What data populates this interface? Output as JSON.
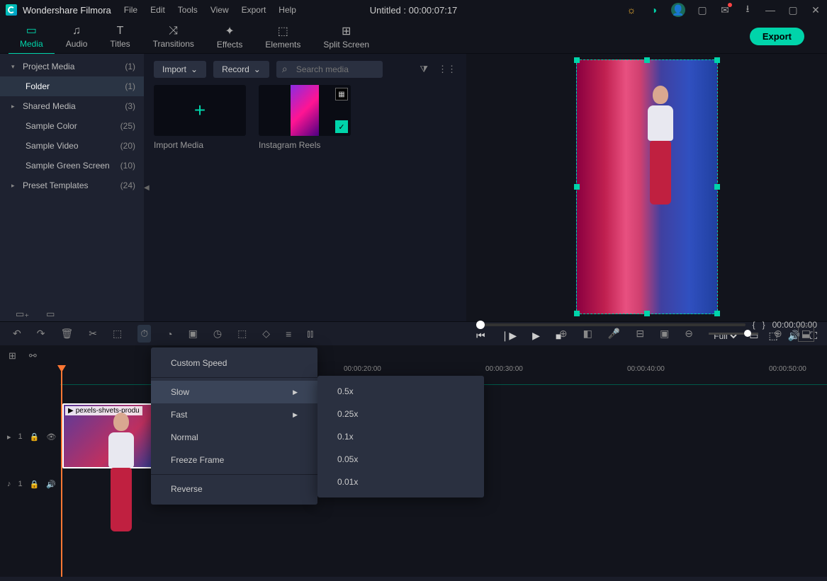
{
  "app": {
    "name": "Wondershare Filmora"
  },
  "menu": {
    "file": "File",
    "edit": "Edit",
    "tools": "Tools",
    "view": "View",
    "export": "Export",
    "help": "Help"
  },
  "document": {
    "title": "Untitled : 00:00:07:17"
  },
  "toolbar": {
    "media": "Media",
    "audio": "Audio",
    "titles": "Titles",
    "transitions": "Transitions",
    "effects": "Effects",
    "elements": "Elements",
    "split_screen": "Split Screen",
    "export": "Export"
  },
  "sidebar": {
    "items": [
      {
        "label": "Project Media",
        "count": "(1)",
        "arrow": "▾"
      },
      {
        "label": "Folder",
        "count": "(1)",
        "arrow": ""
      },
      {
        "label": "Shared Media",
        "count": "(3)",
        "arrow": "▸"
      },
      {
        "label": "Sample Color",
        "count": "(25)",
        "arrow": ""
      },
      {
        "label": "Sample Video",
        "count": "(20)",
        "arrow": ""
      },
      {
        "label": "Sample Green Screen",
        "count": "(10)",
        "arrow": ""
      },
      {
        "label": "Preset Templates",
        "count": "(24)",
        "arrow": "▸"
      }
    ]
  },
  "content": {
    "import": "Import",
    "record": "Record",
    "search_placeholder": "Search media",
    "thumb_import": "Import Media",
    "thumb_reels": "Instagram Reels"
  },
  "preview": {
    "brace_open": "{",
    "brace_close": "}",
    "timecode": "00:00:00:00",
    "full": "Full"
  },
  "ruler": {
    "t0": "|",
    "t1": "00:00:20:00",
    "t2": "00:00:30:00",
    "t3": "00:00:40:00",
    "t4": "00:00:50:00"
  },
  "track": {
    "video_label": "1",
    "audio_label": "1",
    "clip_name": "pexels-shvets-produ"
  },
  "ctx": {
    "custom": "Custom Speed",
    "slow": "Slow",
    "fast": "Fast",
    "normal": "Normal",
    "freeze": "Freeze Frame",
    "reverse": "Reverse"
  },
  "sub": {
    "s1": "0.5x",
    "s2": "0.25x",
    "s3": "0.1x",
    "s4": "0.05x",
    "s5": "0.01x"
  }
}
